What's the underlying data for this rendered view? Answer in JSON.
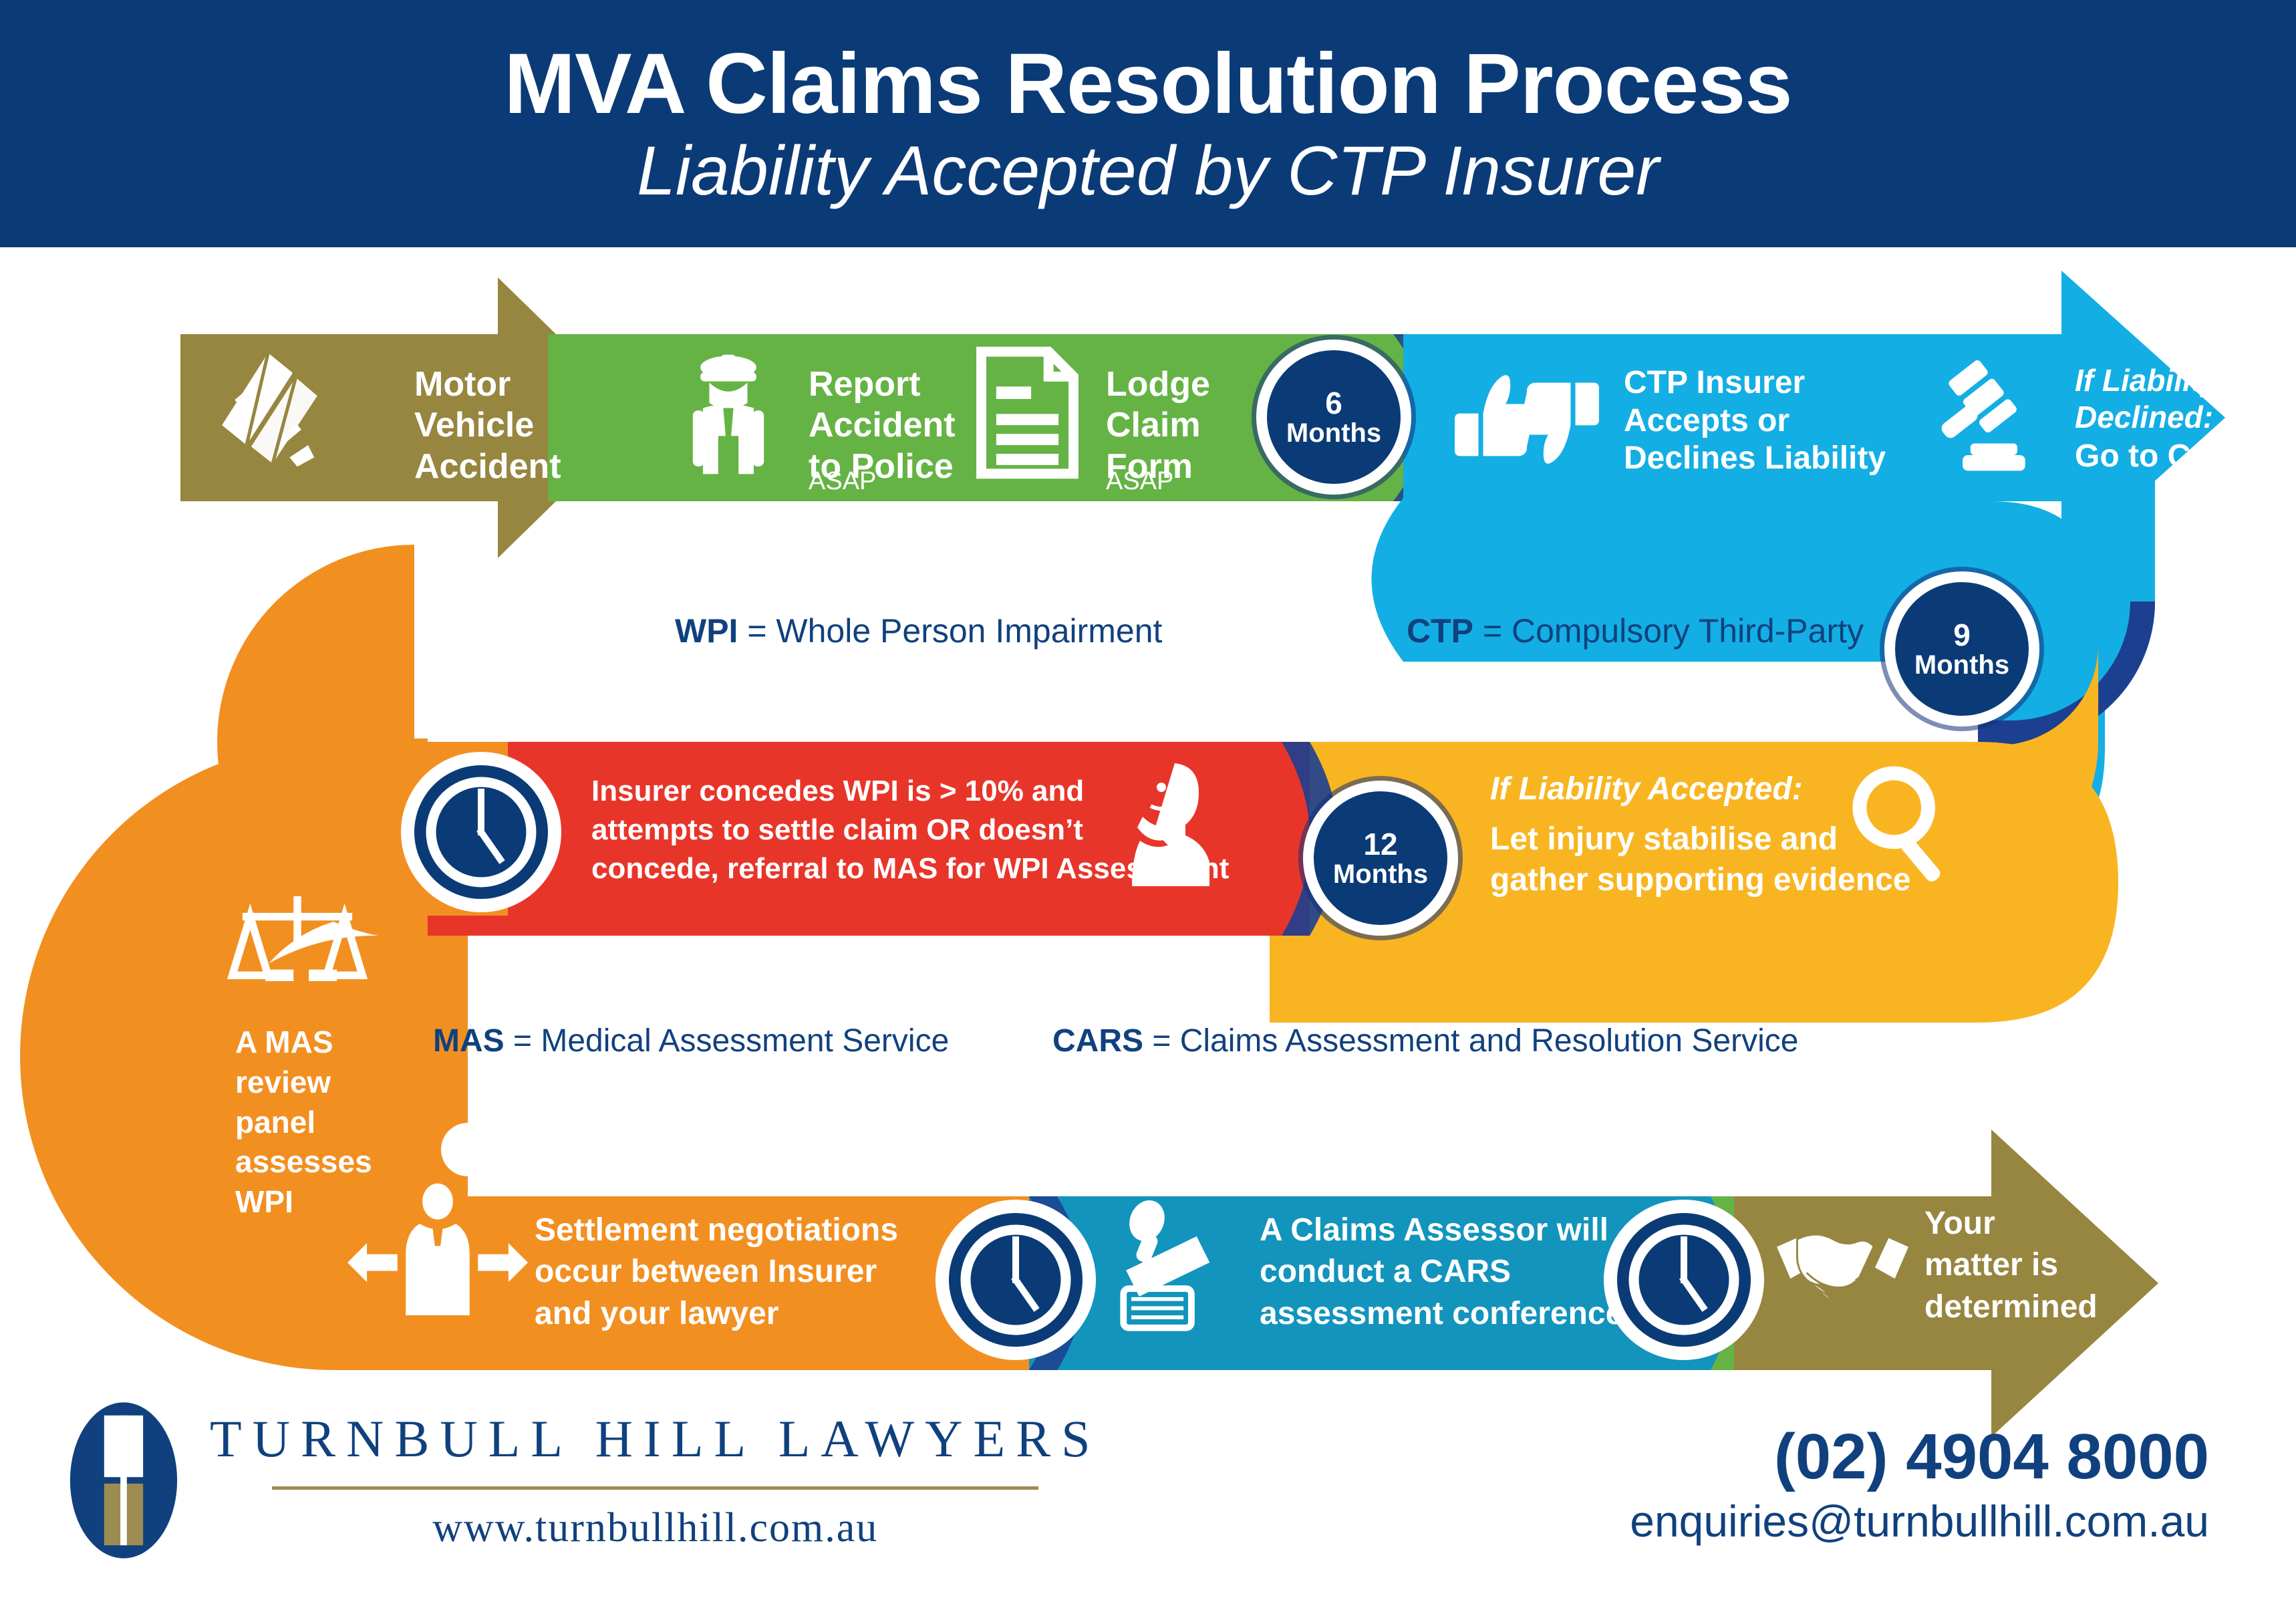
{
  "header": {
    "title": "MVA Claims Resolution Process",
    "subtitle": "Liability Accepted by CTP Insurer",
    "bg_color": "#0b3b77"
  },
  "colors": {
    "navy": "#0b3b77",
    "gold": "#968640",
    "green": "#65b345",
    "cyan": "#13aee4",
    "amber": "#f9b521",
    "red": "#e8352a",
    "orange": "#f28f21",
    "teal": "#1294bd",
    "white": "#ffffff"
  },
  "flow": {
    "row1": [
      {
        "id": "mva",
        "color_key": "gold",
        "icon": "car-crash-icon",
        "label": "Motor\nVehicle\nAccident",
        "note": ""
      },
      {
        "id": "report-police",
        "color_key": "green",
        "icon": "police-officer-icon",
        "label": "Report\nAccident\nto Police",
        "note": "ASAP"
      },
      {
        "id": "lodge-claim",
        "color_key": "green",
        "icon": "claim-form-icon",
        "label": "Lodge\nClaim\nForm",
        "note": "ASAP"
      },
      {
        "id": "ctp-decision",
        "color_key": "cyan",
        "icon": "thumbs-up-down-icon",
        "label": "CTP Insurer\nAccepts or\nDeclines Liability",
        "note": ""
      },
      {
        "id": "go-to-court",
        "color_key": "cyan",
        "icon": "gavel-icon",
        "label_italic": "If Liability\nDeclined:",
        "label": "Go to Court",
        "note": ""
      }
    ],
    "row2": [
      {
        "id": "wpi-concession",
        "color_key": "red",
        "icon": "clock-icon",
        "icon2": "doctor-thinking-icon",
        "label": "Insurer concedes WPI is > 10% and\nattempts to settle claim OR doesn’t\nconcede, referral to MAS for WPI Assessment"
      },
      {
        "id": "injury-stabilise",
        "color_key": "amber",
        "icon": "magnifier-icon",
        "label_italic": "If Liability Accepted:",
        "label": "Let injury stabilise and\ngather supporting evidence"
      }
    ],
    "row3": [
      {
        "id": "mas-review-panel",
        "color_key": "orange",
        "icon": "scales-of-justice-icon",
        "label": "A MAS\nreview\npanel\nassesses\nWPI"
      },
      {
        "id": "settlement-negotiations",
        "color_key": "orange",
        "icon": "negotiation-person-icon",
        "label": "Settlement negotiations\noccur between Insurer\nand your lawyer"
      },
      {
        "id": "cars-conference",
        "color_key": "teal",
        "icon": "stamp-document-icon",
        "label": "A Claims Assessor will\nconduct a CARS\nassessment conference"
      },
      {
        "id": "matter-determined",
        "color_key": "gold",
        "icon": "handshake-icon",
        "label": "Your\nmatter is\ndetermined"
      }
    ],
    "milestones": [
      {
        "id": "m6",
        "number": "6",
        "unit": "Months"
      },
      {
        "id": "m9",
        "number": "9",
        "unit": "Months"
      },
      {
        "id": "m12",
        "number": "12",
        "unit": "Months"
      }
    ]
  },
  "legends": [
    {
      "abbr": "WPI",
      "eq": " = ",
      "definition": "Whole Person Impairment"
    },
    {
      "abbr": "CTP",
      "eq": " = ",
      "definition": "Compulsory Third-Party"
    },
    {
      "abbr": "MAS",
      "eq": " = ",
      "definition": "Medical Assessment Service"
    },
    {
      "abbr": "CARS",
      "eq": " = ",
      "definition": "Claims Assessment and Resolution Service"
    }
  ],
  "footer": {
    "brand_name": "TURNBULL HILL LAWYERS",
    "website": "www.turnbullhill.com.au",
    "phone": "(02) 4904 8000",
    "email": "enquiries@turnbullhill.com.au"
  }
}
